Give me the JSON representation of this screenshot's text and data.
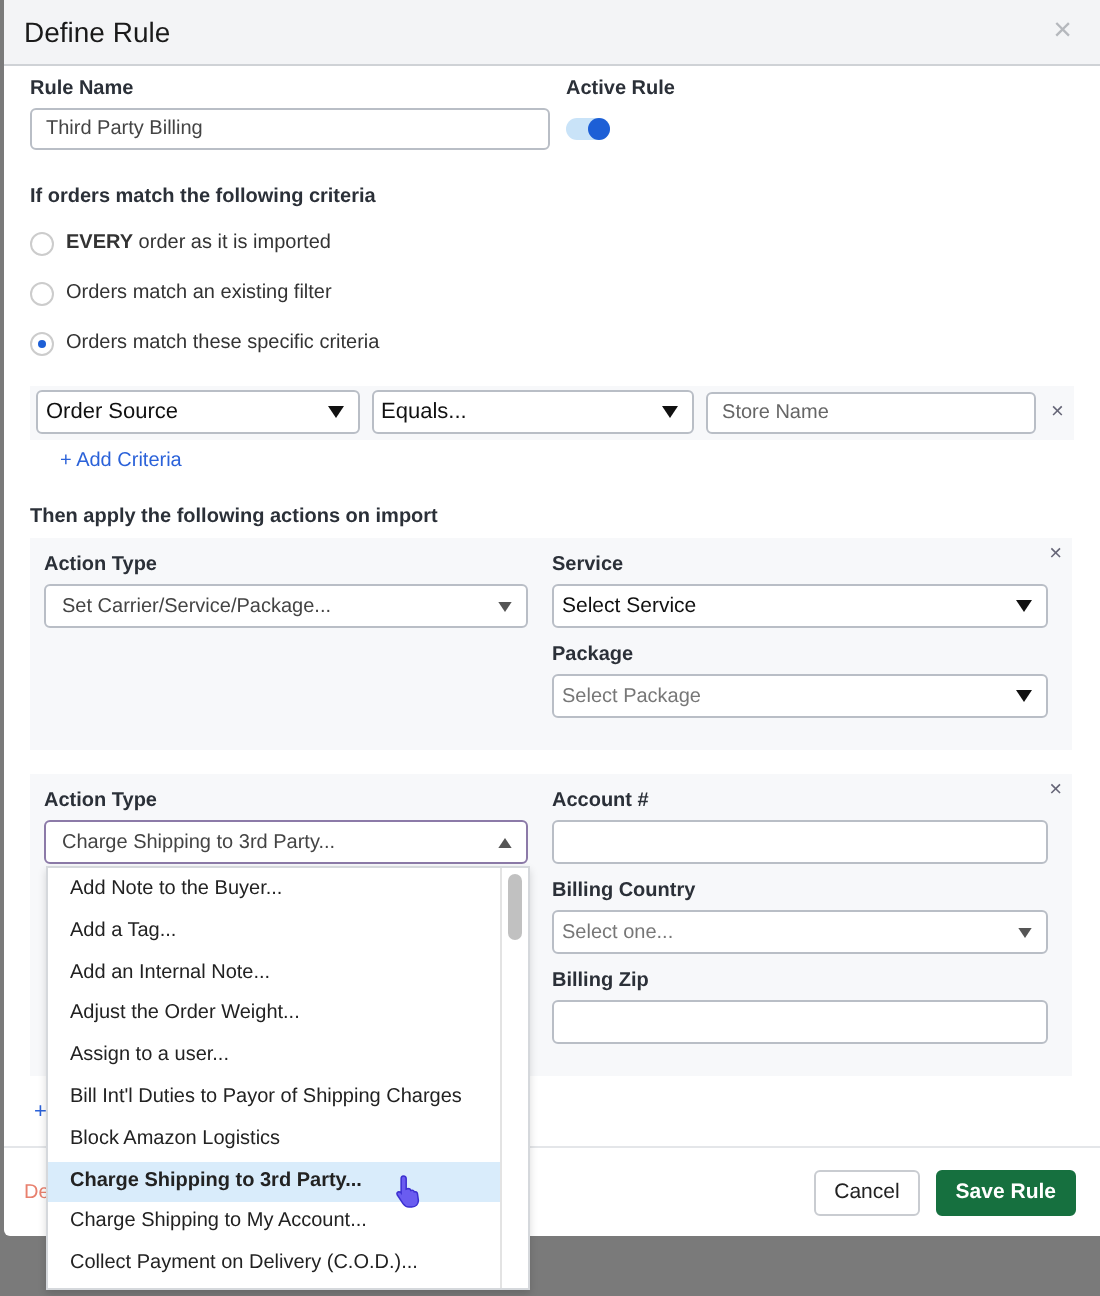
{
  "window": {
    "title": "Define Rule",
    "close": "×"
  },
  "rule_name": {
    "label": "Rule Name",
    "value": "Third Party Billing"
  },
  "active_rule": {
    "label": "Active Rule",
    "on": true
  },
  "criteria": {
    "heading": "If orders match the following criteria",
    "options": [
      {
        "label": "**EVERY** order as it is imported",
        "selected": false
      },
      {
        "label": "Orders match an existing filter",
        "selected": false
      },
      {
        "label": "Orders match these specific criteria",
        "selected": true
      }
    ],
    "row": {
      "field": "Order Source",
      "operator": "Equals...",
      "placeholder": "Store Name",
      "remove": "×"
    },
    "add_link": "+ Add Criteria"
  },
  "actions": {
    "heading": "Then apply the following actions on import",
    "cards": [
      {
        "remove": "×",
        "action_label": "Action Type",
        "action_value": "Set Carrier/Service/Package...",
        "open": false,
        "fields": [
          {
            "label": "Service",
            "kind": "select",
            "value": "Select Service"
          },
          {
            "label": "Package",
            "kind": "select",
            "placeholder": "Select Package"
          }
        ]
      },
      {
        "remove": "×",
        "action_label": "Action Type",
        "action_value": "Charge Shipping to 3rd Party...",
        "open": true,
        "fields": [
          {
            "label": "Account #",
            "kind": "input"
          },
          {
            "label": "Billing Country",
            "kind": "select",
            "placeholder": "Select one..."
          },
          {
            "label": "Billing Zip",
            "kind": "input"
          }
        ]
      }
    ],
    "add_link": "+"
  },
  "dropdown": {
    "items": [
      {
        "label": "Add Note to the Buyer...",
        "selected": false
      },
      {
        "label": "Add a Tag...",
        "selected": false
      },
      {
        "label": "Add an Internal Note...",
        "selected": false
      },
      {
        "label": "Adjust the Order Weight...",
        "selected": false
      },
      {
        "label": "Assign to a user...",
        "selected": false
      },
      {
        "label": "Bill Int'l Duties to Payor of Shipping Charges",
        "selected": false
      },
      {
        "label": "Block Amazon Logistics",
        "selected": false
      },
      {
        "label": "Charge Shipping to 3rd Party...",
        "selected": true
      },
      {
        "label": "Charge Shipping to My Account...",
        "selected": false
      },
      {
        "label": "Collect Payment on Delivery (C.O.D.)...",
        "selected": false
      }
    ]
  },
  "footer": {
    "delete_link": "De",
    "buttons": [
      {
        "label": "Cancel",
        "kind": "secondary"
      },
      {
        "label": "Save Rule",
        "kind": "primary"
      }
    ]
  }
}
